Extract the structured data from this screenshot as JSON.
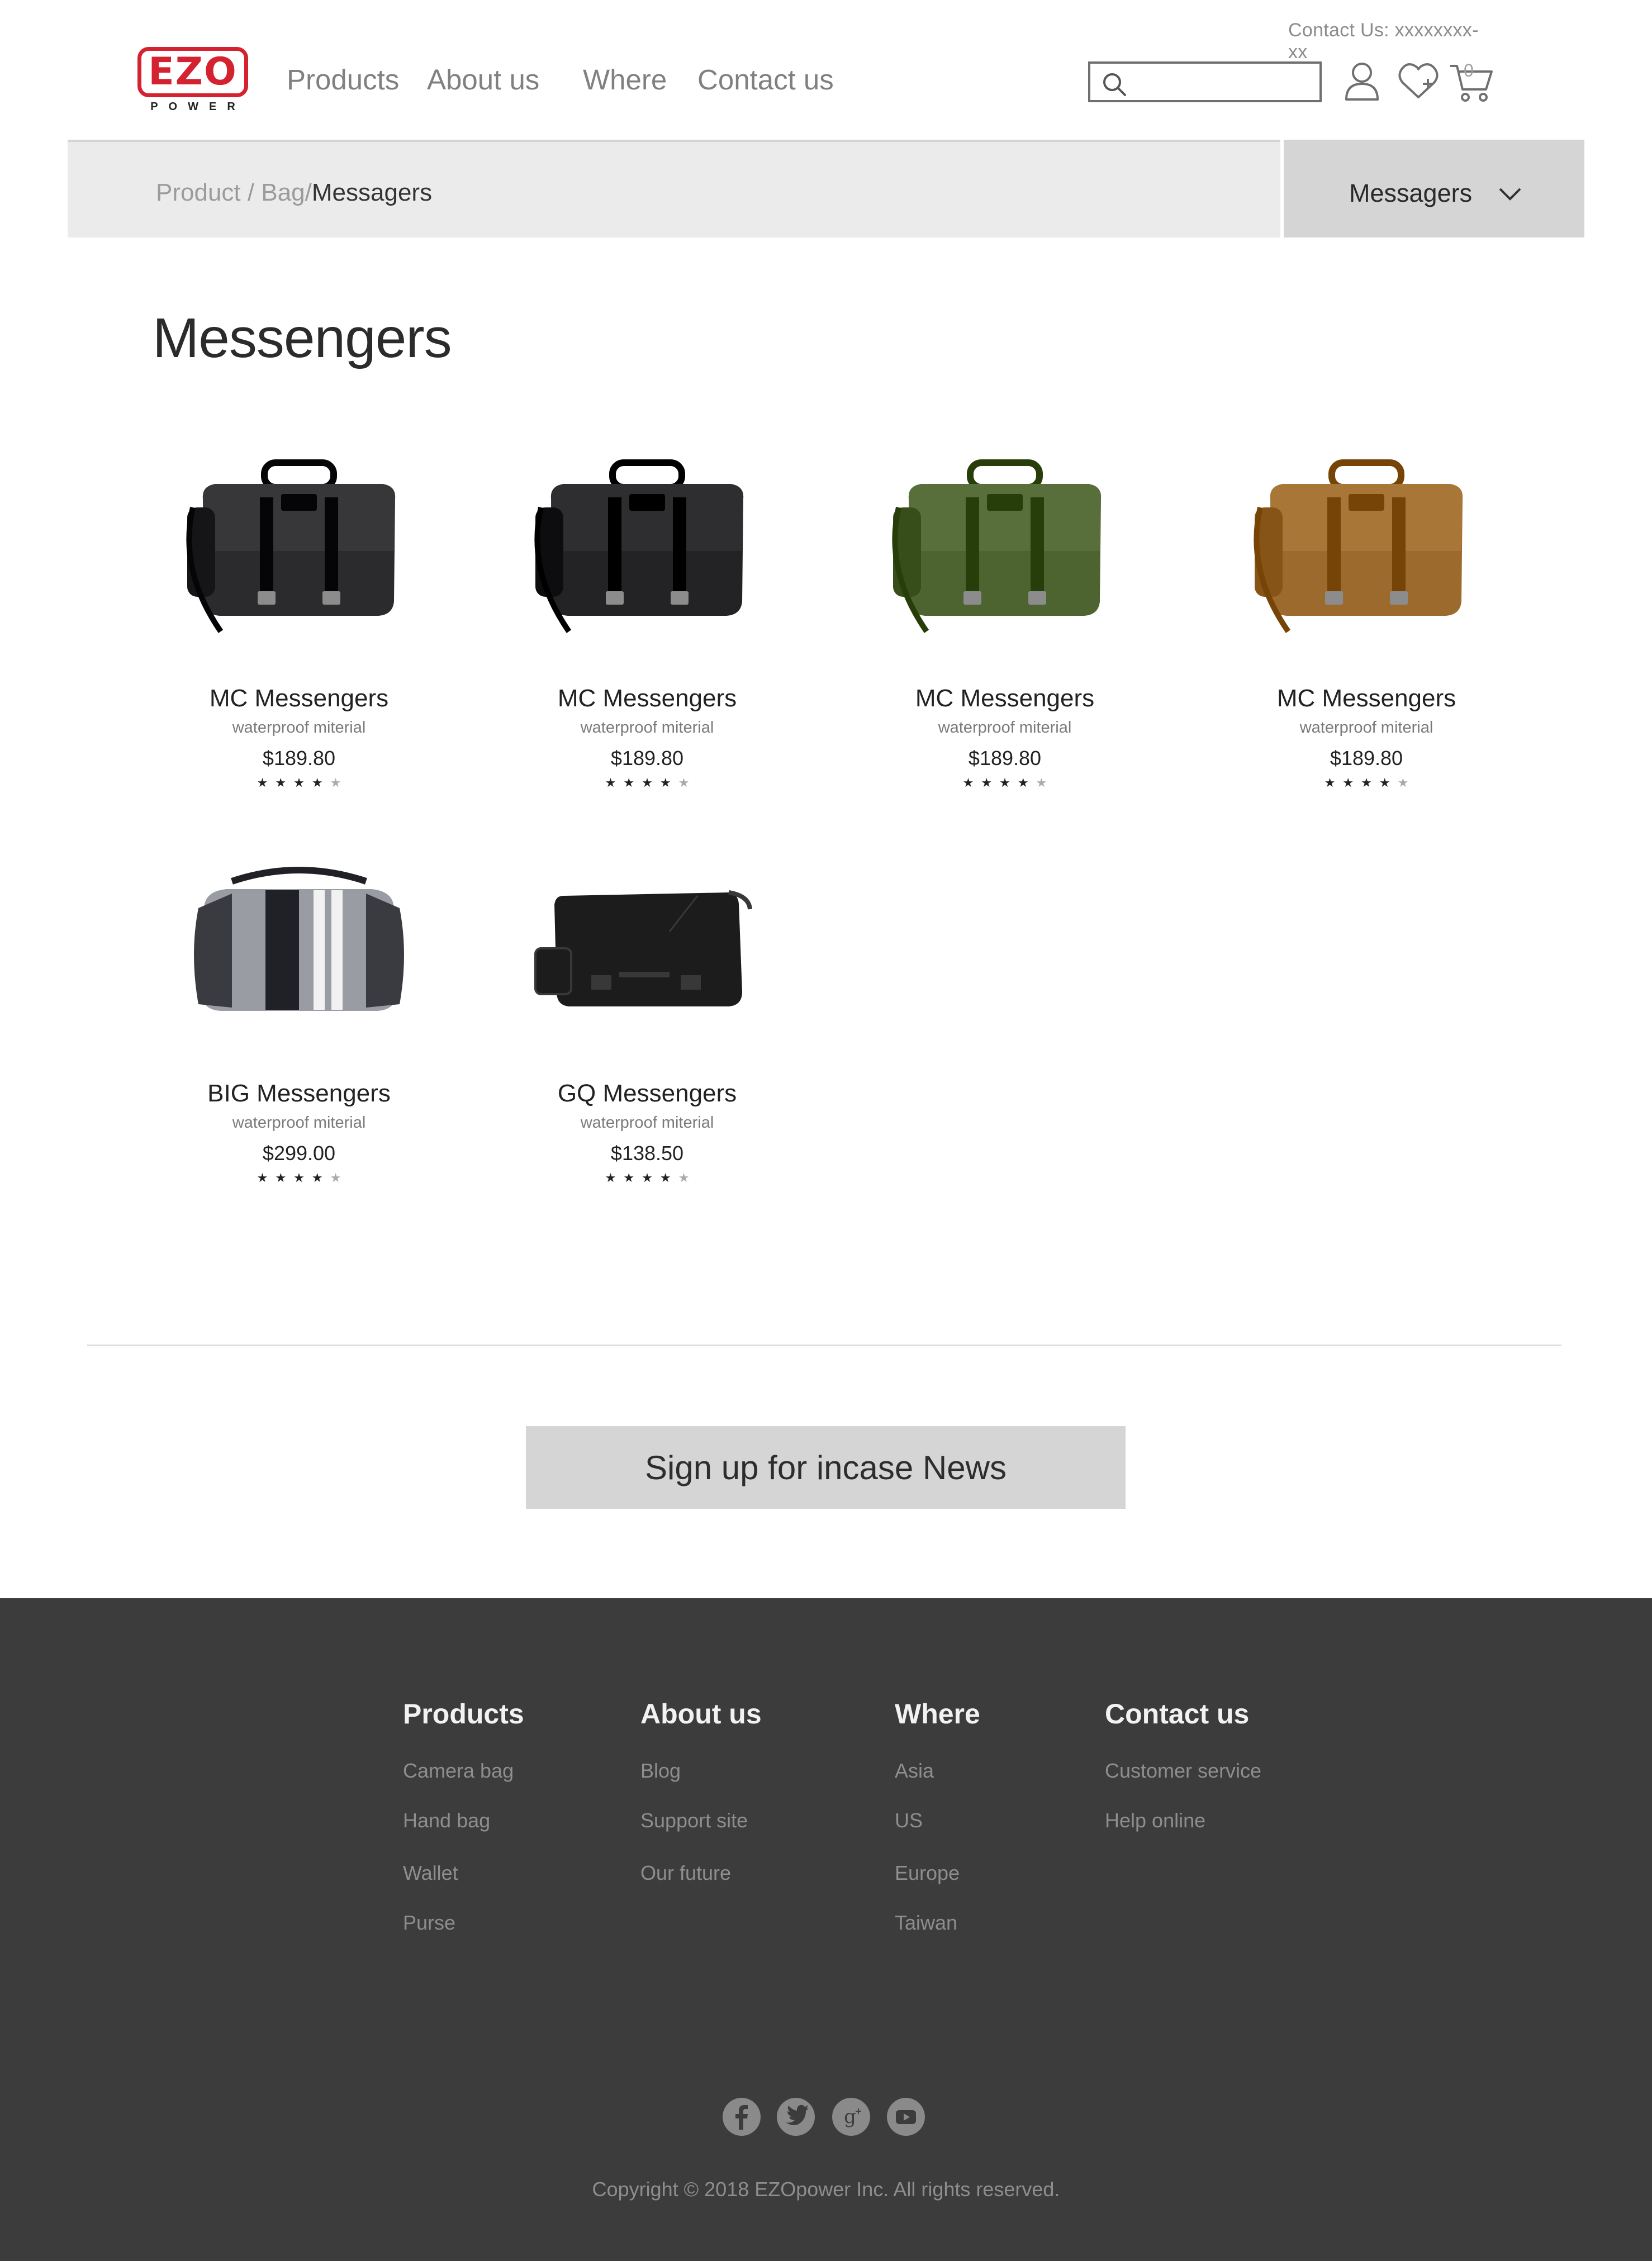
{
  "header": {
    "contact": "Contact Us: xxxxxxxx-xx",
    "logo": {
      "text": "EZO",
      "sub": "POWER"
    },
    "nav": [
      "Products",
      "About us",
      "Where",
      "Contact us"
    ],
    "search_placeholder": "",
    "cart_count": "0"
  },
  "breadcrumb": {
    "items": [
      "Product",
      "Bag"
    ],
    "separator": "/",
    "current": "Messagers"
  },
  "category_select": {
    "value": "Messagers"
  },
  "page_title": "Messengers",
  "products": [
    {
      "name": "MC Messengers",
      "desc": "waterproof miterial",
      "price": "$189.80",
      "rating": 4,
      "max": 5,
      "color": "#2b2b2d"
    },
    {
      "name": "MC Messengers",
      "desc": "waterproof miterial",
      "price": "$189.80",
      "rating": 4,
      "max": 5,
      "color": "#232325"
    },
    {
      "name": "MC Messengers",
      "desc": "waterproof miterial",
      "price": "$189.80",
      "rating": 4,
      "max": 5,
      "color": "#4d6330"
    },
    {
      "name": "MC Messengers",
      "desc": "waterproof miterial",
      "price": "$189.80",
      "rating": 4,
      "max": 5,
      "color": "#9c6a2c"
    },
    {
      "name": "BIG Messengers",
      "desc": "waterproof miterial",
      "price": "$299.00",
      "rating": 4,
      "max": 5,
      "color": "#3a3b40"
    },
    {
      "name": "GQ Messengers",
      "desc": "waterproof miterial",
      "price": "$138.50",
      "rating": 4,
      "max": 5,
      "color": "#1c1c1d"
    }
  ],
  "signup": {
    "label": "Sign up for incase News"
  },
  "footer": {
    "columns": [
      {
        "title": "Products",
        "links": [
          "Camera bag",
          "Hand bag",
          "Wallet",
          "Purse"
        ]
      },
      {
        "title": "About us",
        "links": [
          "Blog",
          "Support site",
          "Our future"
        ]
      },
      {
        "title": "Where",
        "links": [
          "Asia",
          "US",
          "Europe",
          "Taiwan"
        ]
      },
      {
        "title": "Contact us",
        "links": [
          "Customer service",
          "Help online"
        ]
      }
    ],
    "social": [
      "facebook-icon",
      "twitter-icon",
      "google-plus-icon",
      "youtube-icon"
    ],
    "copyright": "Copyright © 2018 EZOpower Inc. All rights reserved."
  },
  "colors": {
    "brand": "#d52230",
    "crumb_bar": "#ebebeb",
    "select_bg": "#d5d5d5",
    "footer_bg": "#3c3c3d"
  }
}
